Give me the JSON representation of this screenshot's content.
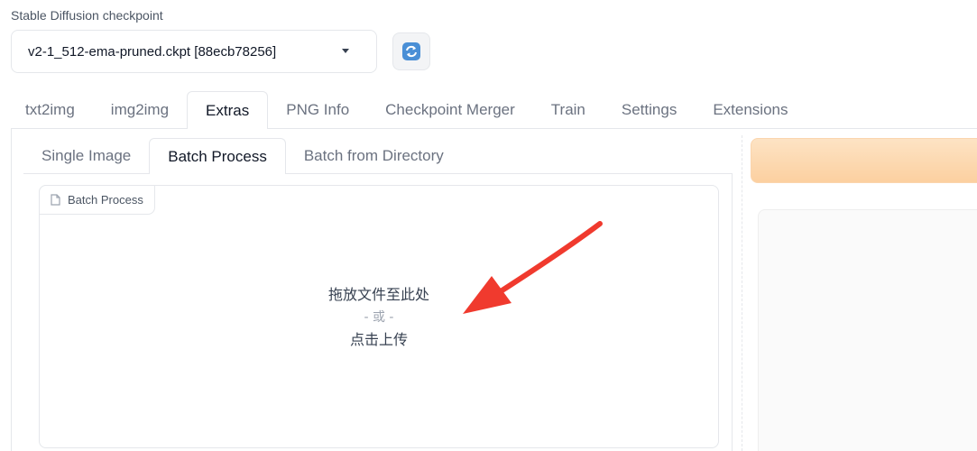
{
  "checkpoint": {
    "label": "Stable Diffusion checkpoint",
    "selected": "v2-1_512-ema-pruned.ckpt [88ecb78256]",
    "refresh_icon": "refresh-icon"
  },
  "top_tabs": [
    {
      "label": "txt2img",
      "active": false
    },
    {
      "label": "img2img",
      "active": false
    },
    {
      "label": "Extras",
      "active": true
    },
    {
      "label": "PNG Info",
      "active": false
    },
    {
      "label": "Checkpoint Merger",
      "active": false
    },
    {
      "label": "Train",
      "active": false
    },
    {
      "label": "Settings",
      "active": false
    },
    {
      "label": "Extensions",
      "active": false
    }
  ],
  "extras_tabs": [
    {
      "label": "Single Image",
      "active": false
    },
    {
      "label": "Batch Process",
      "active": true
    },
    {
      "label": "Batch from Directory",
      "active": false
    }
  ],
  "upload": {
    "label": "Batch Process",
    "label_icon": "file-icon",
    "drop_text": "拖放文件至此处",
    "or_text": "- 或 -",
    "click_text": "点击上传"
  },
  "colors": {
    "accent_orange": "#fcd0a0",
    "annotation_arrow": "#f03a2e"
  }
}
